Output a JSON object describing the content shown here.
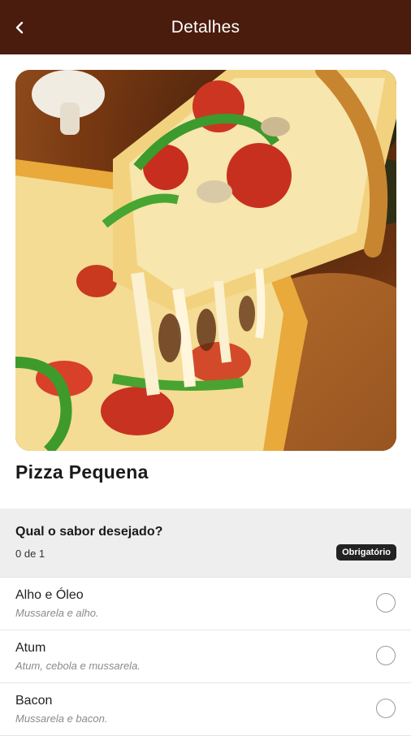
{
  "header": {
    "title": "Detalhes",
    "back_icon": "chevron-left-icon"
  },
  "product": {
    "image_subject": "pizza-slice-photo",
    "name": "Pizza Pequena"
  },
  "option_group": {
    "title": "Qual o sabor desejado?",
    "count": "0 de 1",
    "badge": "Obrigatório",
    "options": [
      {
        "name": "Alho e Óleo",
        "description": "Mussarela e alho.",
        "selected": false
      },
      {
        "name": "Atum",
        "description": "Atum, cebola e mussarela.",
        "selected": false
      },
      {
        "name": "Bacon",
        "description": "Mussarela e bacon.",
        "selected": false
      }
    ]
  },
  "colors": {
    "header_bg": "#4a1c0d",
    "group_bg": "#eeeeee",
    "badge_bg": "#222222"
  }
}
